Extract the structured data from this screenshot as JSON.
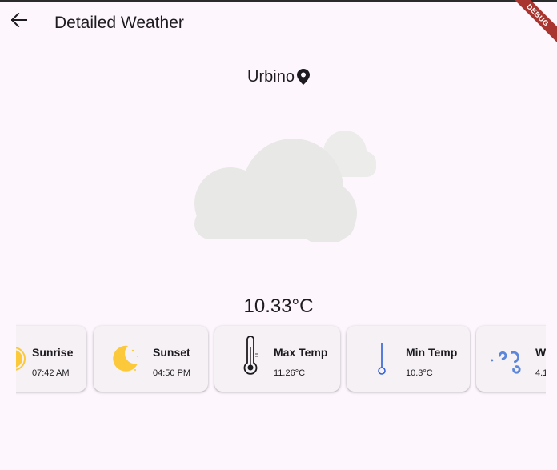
{
  "app_bar": {
    "title": "Detailed Weather",
    "back_icon": "arrow-left-icon"
  },
  "debug_banner": {
    "label": "DEBUG",
    "color": "#a8352f"
  },
  "location": {
    "name": "Urbino",
    "icon": "map-pin-icon"
  },
  "current": {
    "condition_icon": "cloud-icon",
    "temperature": "10.33°C"
  },
  "cards": [
    {
      "label": "Sunrise",
      "value": "07:42 AM",
      "icon": "sun-icon"
    },
    {
      "label": "Sunset",
      "value": "04:50 PM",
      "icon": "moon-icon"
    },
    {
      "label": "Max Temp",
      "value": "11.26°C",
      "icon": "thermometer-icon"
    },
    {
      "label": "Min Temp",
      "value": "10.3°C",
      "icon": "thermometer-low-icon"
    },
    {
      "label": "W",
      "value": "4.1",
      "icon": "wind-icon"
    }
  ],
  "colors": {
    "background": "#fdf7fd",
    "card": "#f5f1f5",
    "sun": "#fbc93a",
    "thermometer_low": "#2f5fd8",
    "wind": "#5b86d9",
    "cloud": "#e8e8e6"
  }
}
